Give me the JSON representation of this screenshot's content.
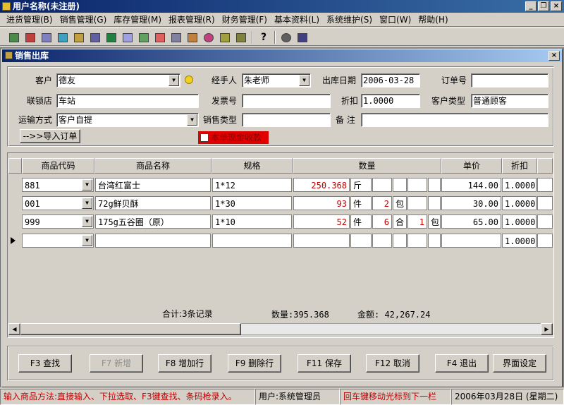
{
  "window": {
    "title": "用户名称(未注册)"
  },
  "menu": [
    "进货管理(B)",
    "销售管理(G)",
    "库存管理(M)",
    "报表管理(R)",
    "财务管理(F)",
    "基本资料(L)",
    "系统维护(S)",
    "窗口(W)",
    "帮助(H)"
  ],
  "child": {
    "title": "销售出库"
  },
  "form": {
    "customer_label": "客户",
    "customer_value": "德友",
    "handler_label": "经手人",
    "handler_value": "朱老师",
    "date_label": "出库日期",
    "date_value": "2006-03-28",
    "order_label": "订单号",
    "order_value": "",
    "store_label": "联锁店",
    "store_value": "车站",
    "invoice_label": "发票号",
    "invoice_value": "",
    "discount_label": "折扣",
    "discount_value": "1.0000",
    "ctype_label": "客户类型",
    "ctype_value": "普通顾客",
    "transport_label": "运输方式",
    "transport_value": "客户自提",
    "stype_label": "销售类型",
    "stype_value": "",
    "remark_label": "备 注",
    "remark_value": "",
    "import_btn": "-->>导入订单",
    "cash_label": "本单现金收款"
  },
  "grid": {
    "headers": [
      "商品代码",
      "商品名称",
      "规格",
      "数量",
      "单价",
      "折扣"
    ],
    "rows": [
      {
        "code": "881",
        "name": "台湾红富士",
        "spec": "1*12",
        "qty": "250.368",
        "u1": "斤",
        "q2": "",
        "u2": "",
        "q3": "",
        "u3": "",
        "price": "144.00",
        "disc": "1.0000"
      },
      {
        "code": "001",
        "name": "72g鲜贝酥",
        "spec": "1*30",
        "qty": "93",
        "u1": "件",
        "q2": "2",
        "u2": "包",
        "q3": "",
        "u3": "",
        "price": "30.00",
        "disc": "1.0000"
      },
      {
        "code": "999",
        "name": "175g五谷圈（原）",
        "spec": "1*10",
        "qty": "52",
        "u1": "件",
        "q2": "6",
        "u2": "合",
        "q3": "1",
        "u3": "包",
        "price": "65.00",
        "disc": "1.0000"
      },
      {
        "code": "",
        "name": "",
        "spec": "",
        "qty": "",
        "u1": "",
        "q2": "",
        "u2": "",
        "q3": "",
        "u3": "",
        "price": "",
        "disc": "1.0000"
      }
    ],
    "total_label": "合计:3条记录",
    "qty_total": "数量:395.368",
    "amount_total": "金额: 42,267.24"
  },
  "buttons": [
    "F3 查找",
    "F7 新增",
    "F8 增加行",
    "F9 删除行",
    "F11 保存",
    "F12 取消",
    "F4 退出",
    "界面设定"
  ],
  "status": {
    "hint": "输入商品方法:直接输入、下拉选取、F3键查找、条码枪录入。",
    "user": "用户:系统管理员",
    "enter": "回车键移动光标到下一栏",
    "date": "2006年03月28日 (星期二)"
  },
  "colors": {
    "accent": "#0a246a",
    "hint": "#c00000",
    "cash_bg": "#e00000"
  }
}
